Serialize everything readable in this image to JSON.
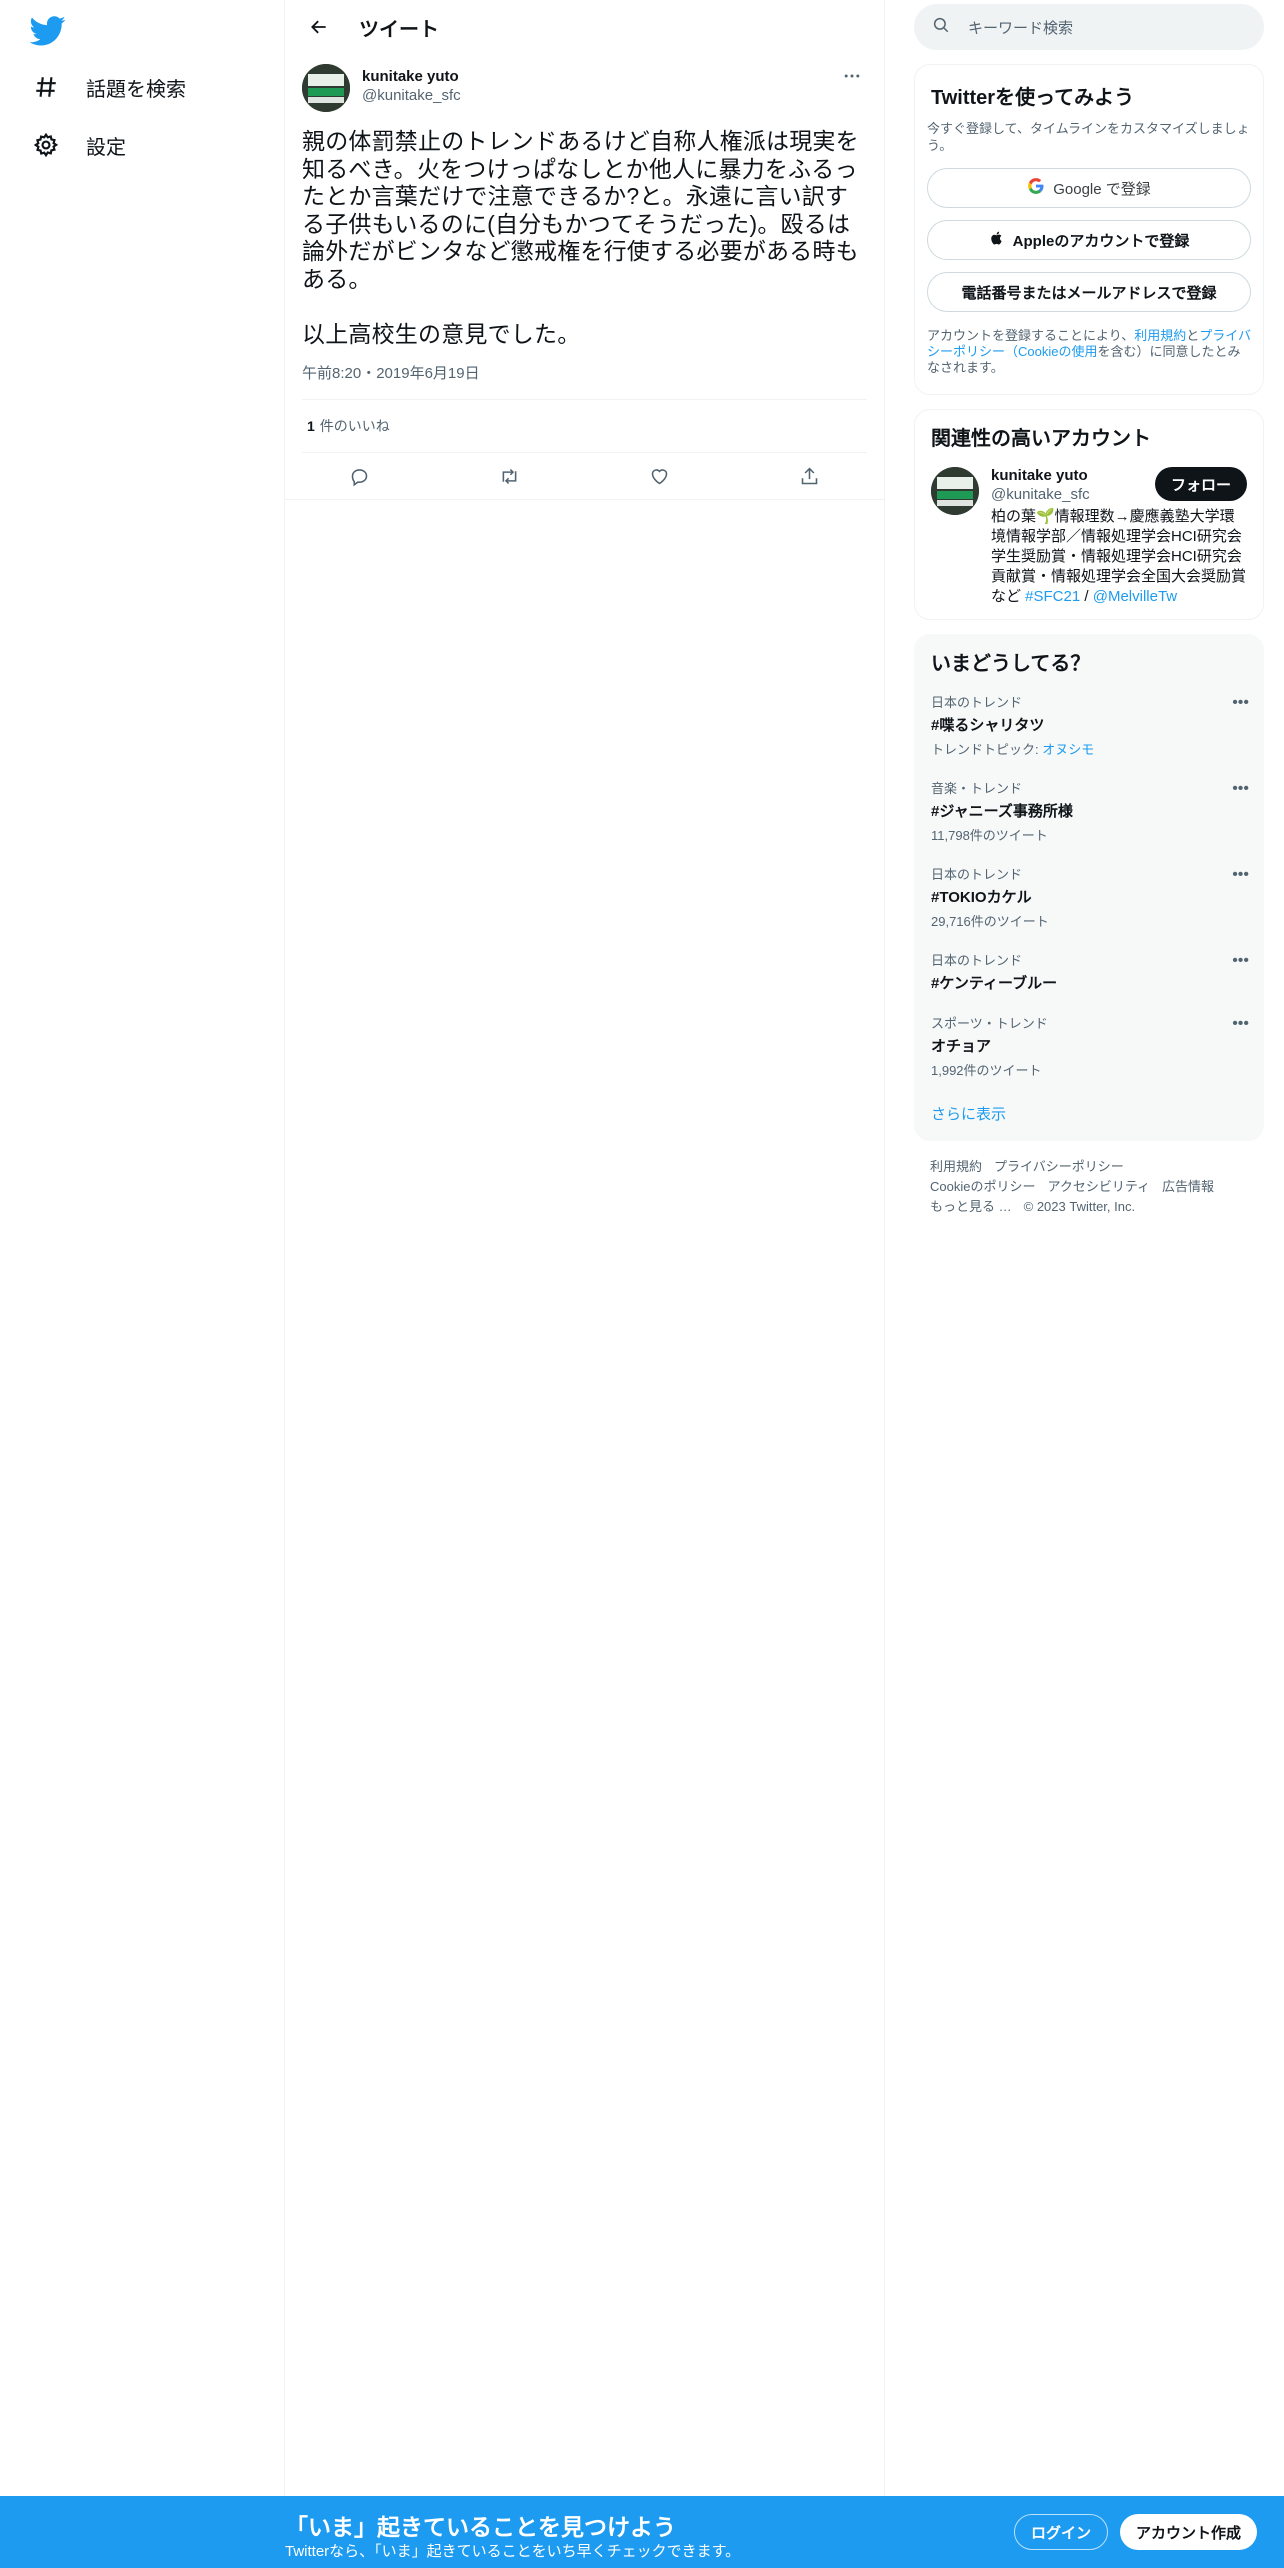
{
  "nav": {
    "items": [
      {
        "label": "話題を検索",
        "icon": "hashtag-icon"
      },
      {
        "label": "設定",
        "icon": "gear-icon"
      }
    ]
  },
  "header": {
    "title": "ツイート"
  },
  "tweet": {
    "author_name": "kunitake yuto",
    "author_handle": "@kunitake_sfc",
    "text": "親の体罰禁止のトレンドあるけど自称人権派は現実を知るべき。火をつけっぱなしとか他人に暴力をふるったとか言葉だけで注意できるか?と。永遠に言い訳する子供もいるのに(自分もかつてそうだった)。殴るは論外だがビンタなど懲戒権を行使する必要がある時もある。\n\n以上高校生の意見でした。",
    "time": "午前8:20・2019年6月19日",
    "likes_count": "1",
    "likes_label": "件のいいね"
  },
  "search": {
    "placeholder": "キーワード検索"
  },
  "signup": {
    "title": "Twitterを使ってみよう",
    "subtitle": "今すぐ登録して、タイムラインをカスタマイズしましょう。",
    "google_label": "Google で登録",
    "apple_label": "Appleのアカウントで登録",
    "phone_label": "電話番号またはメールアドレスで登録",
    "terms_prefix": "アカウントを登録することにより、",
    "terms_link1": "利用規約",
    "terms_and": "と",
    "terms_link2": "プライバシーポリシー（Cookieの使用",
    "terms_suffix": "を含む）に同意したとみなされます。"
  },
  "related": {
    "title": "関連性の高いアカウント",
    "name": "kunitake yuto",
    "handle": "@kunitake_sfc",
    "follow_label": "フォロー",
    "bio": "柏の葉🌱情報理数→慶應義塾大学環境情報学部／情報処理学会HCI研究会学生奨励賞・情報処理学会HCI研究会貢献賞・情報処理学会全国大会奨励賞など ",
    "bio_link1": "#SFC21",
    "bio_sep": " / ",
    "bio_link2": "@MelvilleTw"
  },
  "trends": {
    "title": "いまどうしてる？",
    "items": [
      {
        "context": "日本のトレンド",
        "name": "#喋るシャリタツ",
        "meta_prefix": "トレンドトピック: ",
        "meta_link": "オヌシモ"
      },
      {
        "context": "音楽・トレンド",
        "name": "#ジャニーズ事務所様",
        "meta": "11,798件のツイート"
      },
      {
        "context": "日本のトレンド",
        "name": "#TOKIOカケル",
        "meta": "29,716件のツイート"
      },
      {
        "context": "日本のトレンド",
        "name": "#ケンティーブルー"
      },
      {
        "context": "スポーツ・トレンド",
        "name": "オチョア",
        "meta": "1,992件のツイート"
      }
    ],
    "show_more": "さらに表示"
  },
  "footer": {
    "links": [
      "利用規約",
      "プライバシーポリシー",
      "Cookieのポリシー",
      "アクセシビリティ",
      "広告情報",
      "もっと見る …"
    ],
    "copyright": "© 2023 Twitter, Inc."
  },
  "bottom": {
    "title": "「いま」起きていることを見つけよう",
    "subtitle": "Twitterなら、「いま」起きていることをいち早くチェックできます。",
    "login_label": "ログイン",
    "register_label": "アカウント作成"
  },
  "colors": {
    "brand": "#1d9bf0",
    "text": "#0f1419",
    "muted": "#536471"
  }
}
